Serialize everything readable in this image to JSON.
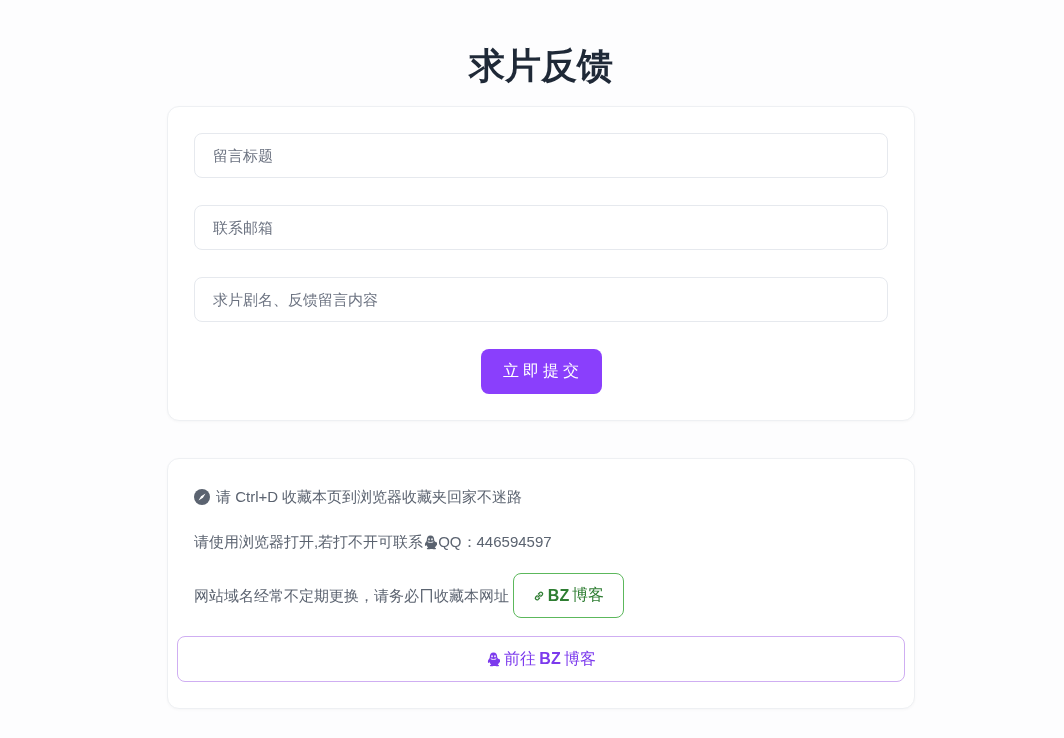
{
  "title": "求片反馈",
  "form": {
    "fields": [
      {
        "placeholder": "留言标题"
      },
      {
        "placeholder": "联系邮箱"
      },
      {
        "placeholder": "求片剧名、反馈留言内容"
      }
    ],
    "submit": "立即提交"
  },
  "notice": {
    "bookmark_tip": "请 Ctrl+D 收藏本页到浏览器收藏夹回家不迷路",
    "contact": {
      "text": "请使用浏览器打开,若打不开可联系",
      "qq": "QQ：446594597"
    },
    "domain": {
      "text_before": "网站域名经常不定期更换，请务必",
      "text_after": "收藏本网址",
      "link": "**BZ**博客"
    },
    "goto_button": "前往**BZ**博客"
  }
}
